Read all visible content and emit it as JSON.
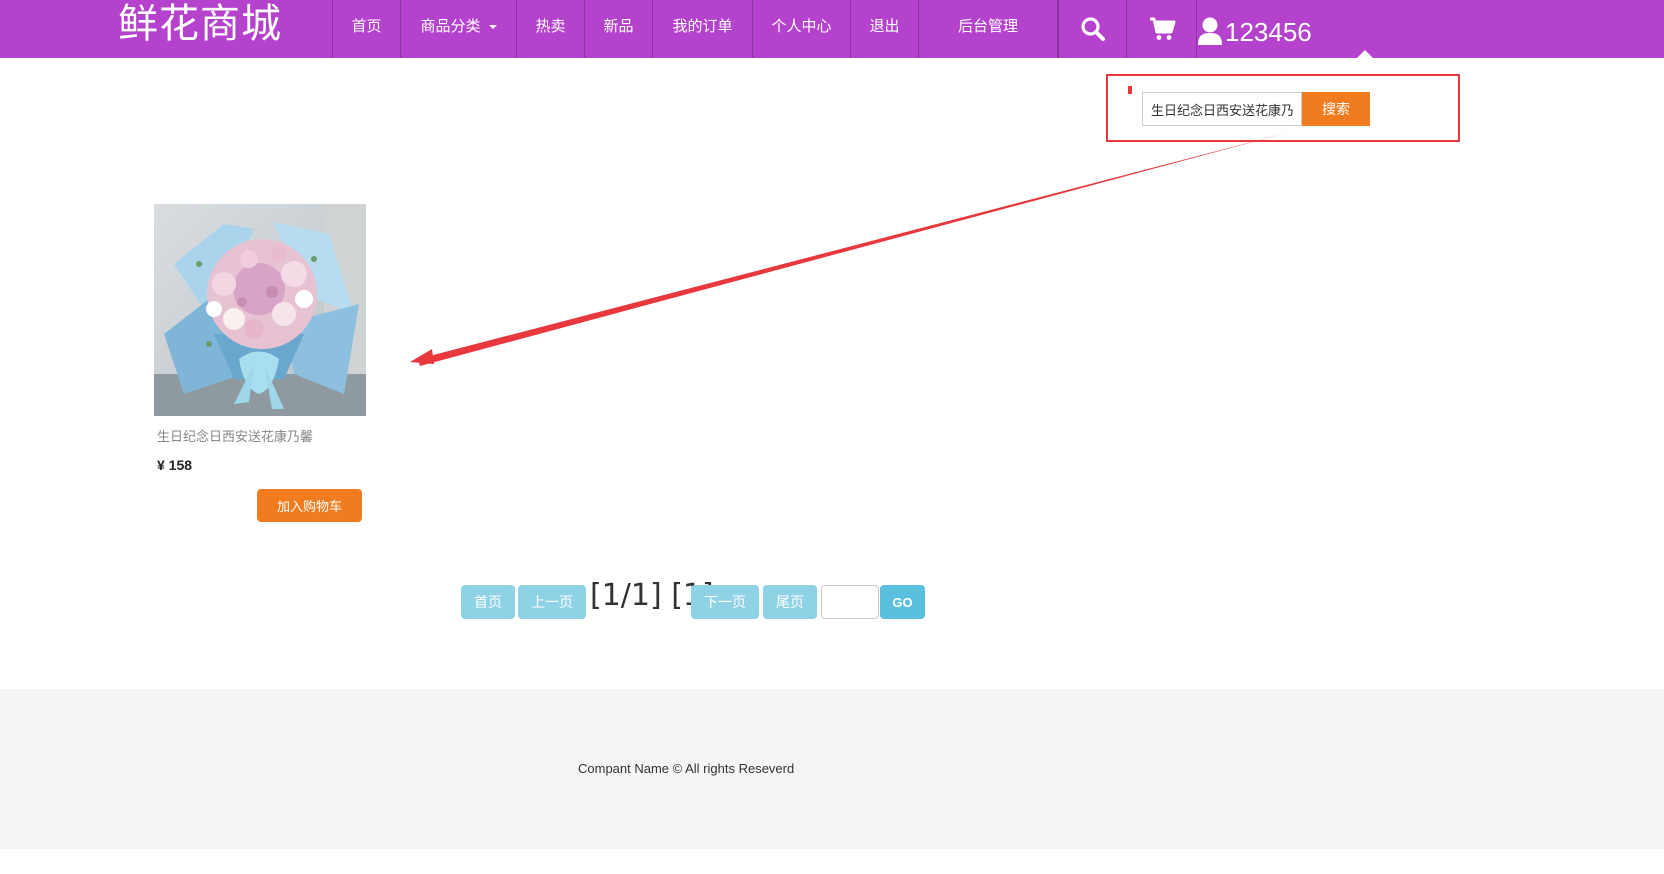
{
  "brand": "鲜花商城",
  "nav": {
    "home": "首页",
    "category": "商品分类",
    "hot": "热卖",
    "new": "新品",
    "orders": "我的订单",
    "profile": "个人中心",
    "logout": "退出",
    "admin": "后台管理"
  },
  "user": {
    "name": "123456"
  },
  "icons": {
    "search": "search-icon",
    "cart": "cart-icon",
    "user": "user-icon"
  },
  "search": {
    "value": "生日纪念日西安送花康乃馨",
    "button": "搜索"
  },
  "product": {
    "name": "生日纪念日西安送花康乃馨",
    "price": "¥ 158",
    "add_to_cart": "加入购物车"
  },
  "pagination": {
    "first": "首页",
    "prev": "上一页",
    "info": "[1/1] [1]",
    "next": "下一页",
    "last": "尾页",
    "go": "GO"
  },
  "footer": {
    "text": "Compant Name © All rights Reseverd"
  },
  "colors": {
    "nav_bg": "#b442cc",
    "accent_orange": "#f07c1f",
    "pager_btn": "#8fd2e6",
    "go_btn": "#5bc0de",
    "annotation_red": "#e8383d"
  }
}
